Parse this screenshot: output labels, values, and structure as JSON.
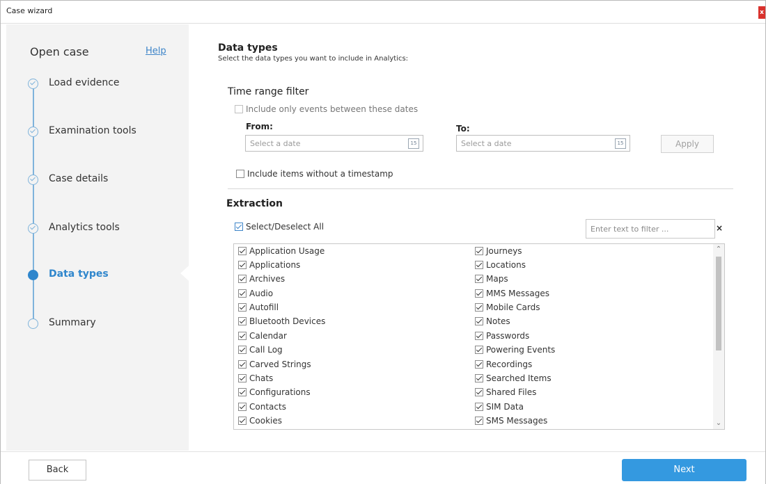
{
  "window": {
    "title": "Case wizard",
    "close_glyph": "x"
  },
  "sidebar": {
    "heading": "Open case",
    "help": "Help",
    "steps": [
      {
        "label": "Load evidence",
        "state": "done"
      },
      {
        "label": "Examination tools",
        "state": "done"
      },
      {
        "label": "Case details",
        "state": "done"
      },
      {
        "label": "Analytics tools",
        "state": "done"
      },
      {
        "label": "Data types",
        "state": "active"
      },
      {
        "label": "Summary",
        "state": "pending"
      }
    ]
  },
  "main": {
    "title": "Data types",
    "subtitle": "Select the data types you want to include in Analytics:",
    "time_range": {
      "title": "Time range filter",
      "include_between_label": "Include only events between these dates",
      "from_label": "From:",
      "to_label": "To:",
      "from_placeholder": "Select a date",
      "to_placeholder": "Select a date",
      "calendar_glyph": "15",
      "apply_label": "Apply",
      "include_no_timestamp_label": "Include items without a timestamp"
    },
    "extraction": {
      "title": "Extraction",
      "select_all_label": "Select/Deselect All",
      "filter_placeholder": "Enter text to filter ...",
      "filter_clear": "×",
      "left_items": [
        "Application Usage",
        "Applications",
        "Archives",
        "Audio",
        "Autofill",
        "Bluetooth Devices",
        "Calendar",
        "Call Log",
        "Carved Strings",
        "Chats",
        "Configurations",
        "Contacts",
        "Cookies"
      ],
      "right_items": [
        "Journeys",
        "Locations",
        "Maps",
        "MMS Messages",
        "Mobile Cards",
        "Notes",
        "Passwords",
        "Powering Events",
        "Recordings",
        "Searched Items",
        "Shared Files",
        "SIM Data",
        "SMS Messages"
      ]
    }
  },
  "footer": {
    "back_label": "Back",
    "next_label": "Next"
  },
  "colors": {
    "accent": "#3499e0",
    "step_line": "#7fb3db",
    "active_step": "#2f86cc",
    "close": "#d9312c"
  }
}
